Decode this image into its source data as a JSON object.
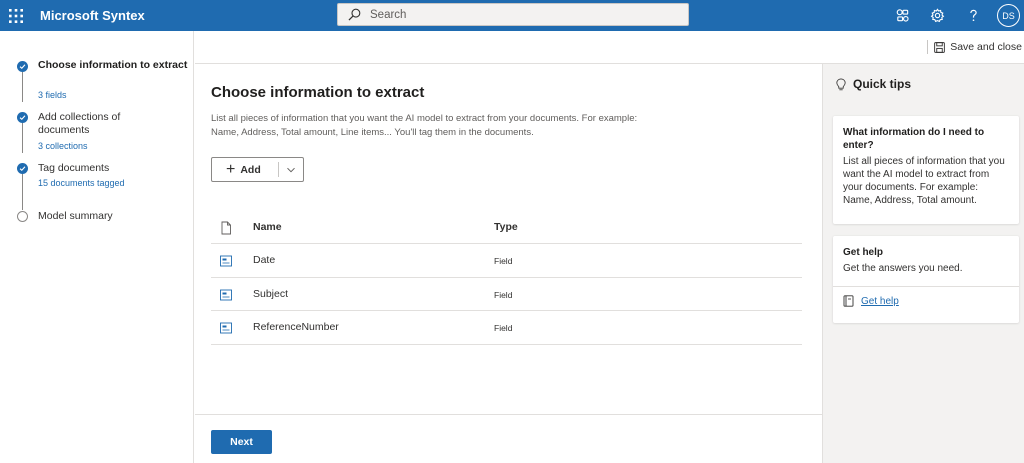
{
  "topbar": {
    "app_title": "Microsoft Syntex",
    "search_placeholder": "Search",
    "user_initials": "DS"
  },
  "steps": [
    {
      "title": "Choose information to extract",
      "subtitle": "3 fields",
      "state": "complete",
      "active": true
    },
    {
      "title": "Add collections of documents",
      "subtitle": "3 collections",
      "state": "complete",
      "active": false
    },
    {
      "title": "Tag documents",
      "subtitle": "15 documents tagged",
      "state": "complete",
      "active": false
    },
    {
      "title": "Model summary",
      "subtitle": "",
      "state": "pending",
      "active": false
    }
  ],
  "commandbar": {
    "save_close_label": "Save and close"
  },
  "main": {
    "title": "Choose information to extract",
    "description": "List all pieces of information that you want the AI model to extract from your documents. For example: Name, Address, Total amount, Line items... You'll tag them in the documents.",
    "add_label": "Add",
    "table": {
      "headers": {
        "name": "Name",
        "type": "Type"
      },
      "rows": [
        {
          "name": "Date",
          "type": "Field"
        },
        {
          "name": "Subject",
          "type": "Field"
        },
        {
          "name": "ReferenceNumber",
          "type": "Field"
        }
      ]
    },
    "next_label": "Next"
  },
  "tips": {
    "title": "Quick tips",
    "card1": {
      "heading": "What information do I need to enter?",
      "body": "List all pieces of information that you want the AI model to extract from your documents. For example: Name, Address, Total amount."
    },
    "card2": {
      "heading": "Get help",
      "body": "Get the answers you need.",
      "link": "Get help"
    }
  },
  "colors": {
    "brand": "#1f6bb0",
    "panel_bg": "#f3f2f1",
    "border": "#e1dfdd"
  }
}
